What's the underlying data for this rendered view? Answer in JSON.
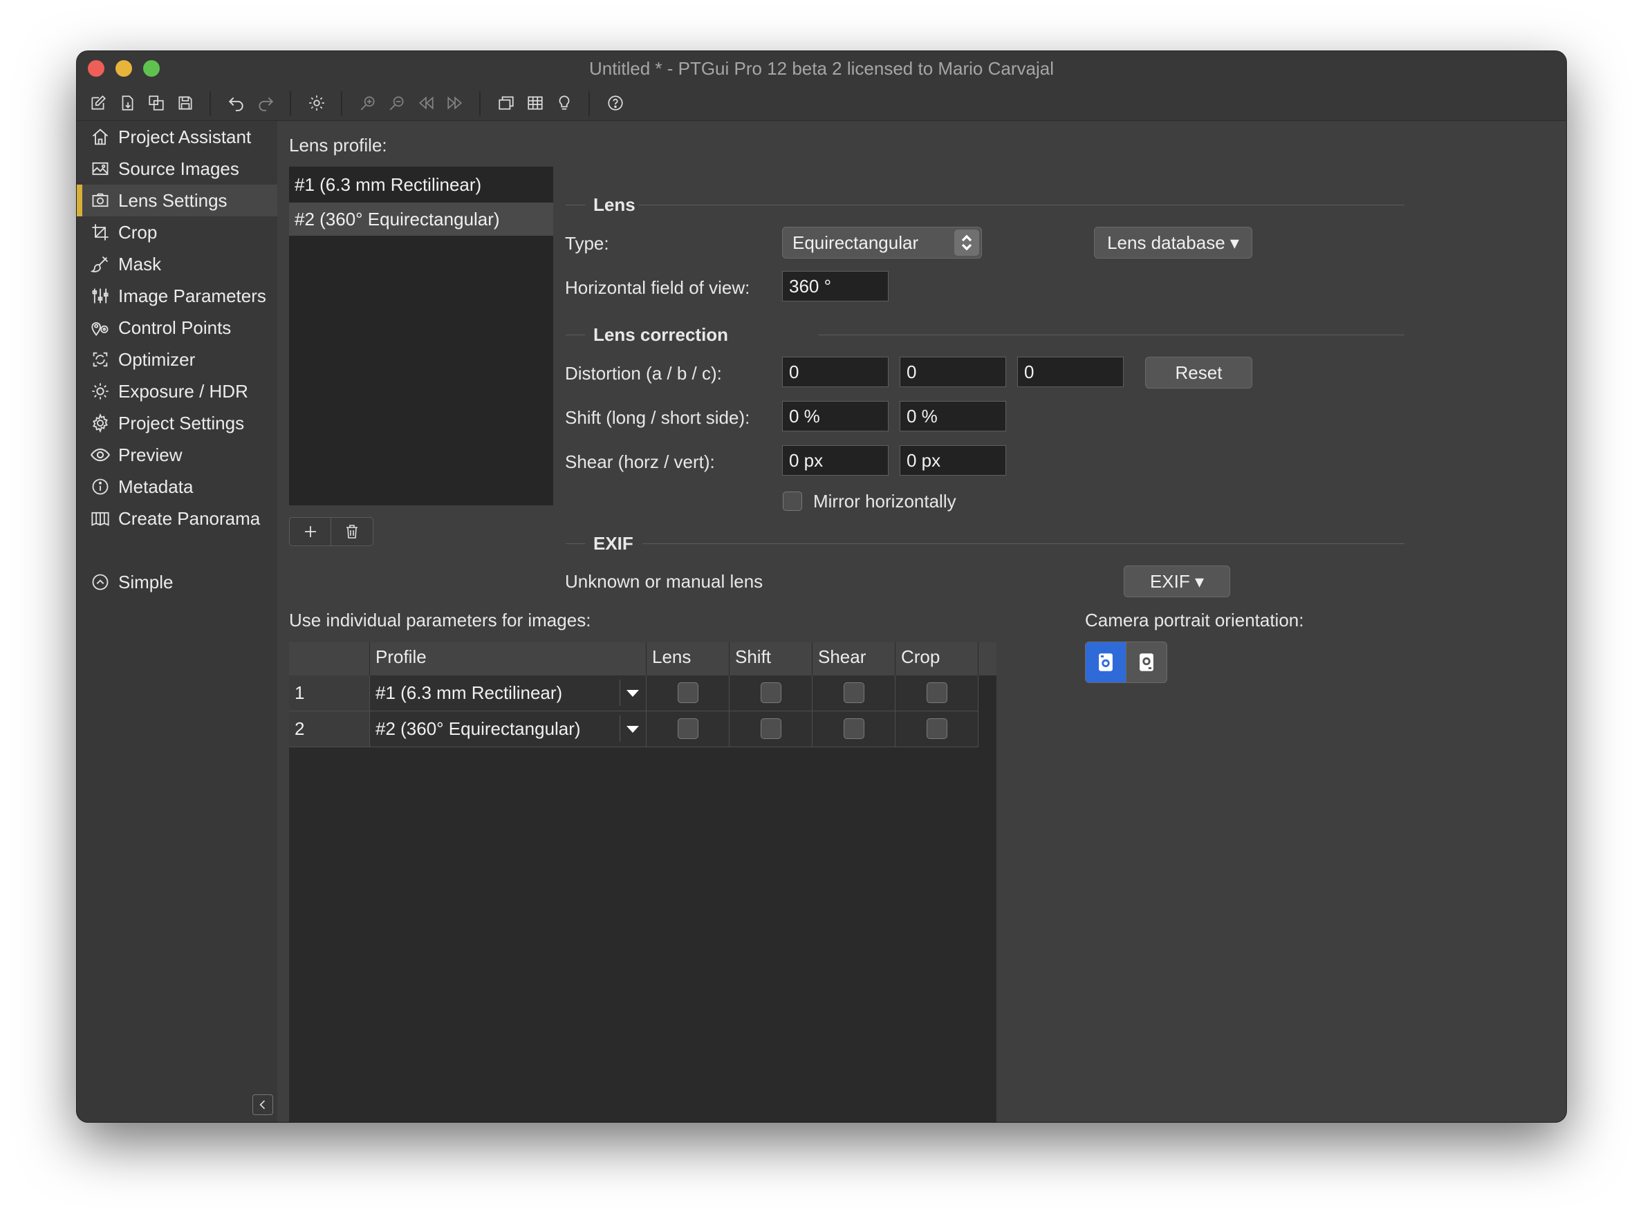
{
  "window": {
    "title": "Untitled * - PTGui Pro 12 beta 2 licensed to Mario Carvajal"
  },
  "toolbar": {
    "icons": [
      "new-project-icon",
      "open-project-icon",
      "duplicate-icon",
      "save-icon",
      "undo-icon",
      "redo-icon",
      "settings-icon",
      "zoom-in-icon",
      "zoom-out-icon",
      "previous-icon",
      "next-icon",
      "panorama-editor-icon",
      "table-icon",
      "lightbulb-icon",
      "help-icon"
    ]
  },
  "sidebar": {
    "items": [
      {
        "label": "Project Assistant",
        "icon": "home-icon"
      },
      {
        "label": "Source Images",
        "icon": "image-icon"
      },
      {
        "label": "Lens Settings",
        "icon": "camera-icon"
      },
      {
        "label": "Crop",
        "icon": "crop-icon"
      },
      {
        "label": "Mask",
        "icon": "brush-icon"
      },
      {
        "label": "Image Parameters",
        "icon": "sliders-icon"
      },
      {
        "label": "Control Points",
        "icon": "map-pin-icon"
      },
      {
        "label": "Optimizer",
        "icon": "optimize-icon"
      },
      {
        "label": "Exposure / HDR",
        "icon": "sun-icon"
      },
      {
        "label": "Project Settings",
        "icon": "gear-icon"
      },
      {
        "label": "Preview",
        "icon": "eye-icon"
      },
      {
        "label": "Metadata",
        "icon": "info-icon"
      },
      {
        "label": "Create Panorama",
        "icon": "panorama-icon"
      }
    ],
    "active_index": 2,
    "simple_label": "Simple"
  },
  "lens_profile": {
    "label": "Lens profile:",
    "items": [
      "#1 (6.3 mm Rectilinear)",
      "#2 (360° Equirectangular)"
    ],
    "selected_index": 1
  },
  "lens": {
    "heading": "Lens",
    "type_label": "Type:",
    "type_value": "Equirectangular",
    "lens_database_label": "Lens database ▾",
    "hfov_label": "Horizontal field of view:",
    "hfov_value": "360 °"
  },
  "lens_correction": {
    "heading": "Lens correction",
    "distortion_label": "Distortion (a / b / c):",
    "distortion_values": [
      "0",
      "0",
      "0"
    ],
    "reset_label": "Reset",
    "shift_label": "Shift (long / short side):",
    "shift_values": [
      "0 %",
      "0 %"
    ],
    "shear_label": "Shear (horz / vert):",
    "shear_values": [
      "0 px",
      "0 px"
    ],
    "mirror_label": "Mirror horizontally",
    "mirror_checked": false
  },
  "exif": {
    "heading": "EXIF",
    "status": "Unknown or manual lens",
    "button_label": "EXIF ▾"
  },
  "individual": {
    "label": "Use individual parameters for images:",
    "columns": [
      "",
      "Profile",
      "Lens",
      "Shift",
      "Shear",
      "Crop"
    ],
    "rows": [
      {
        "index": "1",
        "profile": "#1 (6.3 mm Rectilinear)",
        "lens": false,
        "shift": false,
        "shear": false,
        "crop": false
      },
      {
        "index": "2",
        "profile": "#2 (360° Equirectangular)",
        "lens": false,
        "shift": false,
        "shear": false,
        "crop": false
      }
    ]
  },
  "camera_orientation": {
    "label": "Camera portrait orientation:",
    "options": [
      "rotate-left-camera-icon",
      "rotate-right-camera-icon"
    ],
    "selected_index": 0
  },
  "colors": {
    "accent": "#2f6ad9",
    "active_marker": "#d7b03a",
    "window_bg": "#3a3a3a"
  }
}
